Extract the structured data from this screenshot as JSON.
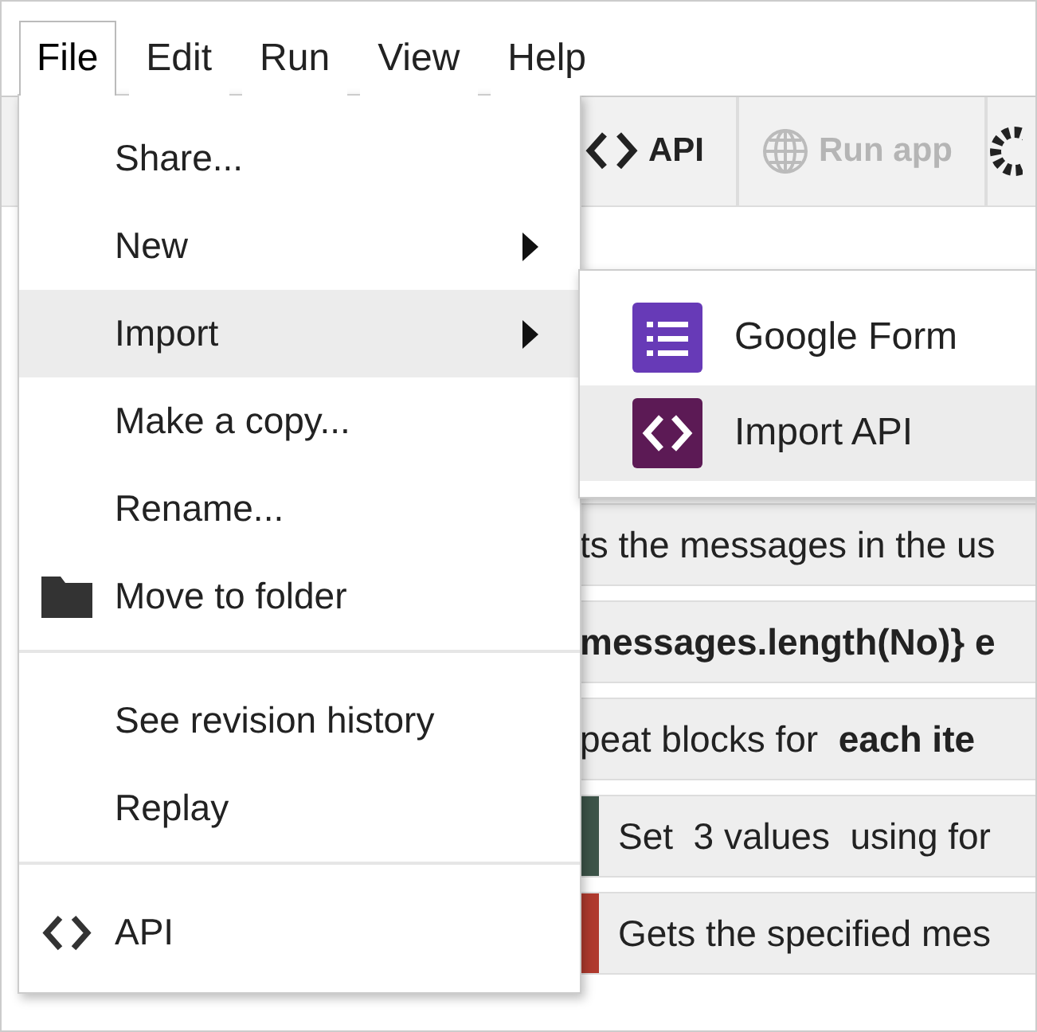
{
  "menubar": [
    {
      "label": "File",
      "selected": true
    },
    {
      "label": "Edit",
      "selected": false
    },
    {
      "label": "Run",
      "selected": false
    },
    {
      "label": "View",
      "selected": false
    },
    {
      "label": "Help",
      "selected": false
    }
  ],
  "toolbar": [
    {
      "label": "API",
      "kind": "api",
      "disabled": false
    },
    {
      "label": "Run app",
      "kind": "run",
      "disabled": true
    }
  ],
  "blocks": [
    {
      "text": "ts the messages in the us",
      "kind": "plain"
    },
    {
      "text": "messages.length(No)} e",
      "kind": "bold"
    },
    {
      "text": "peat blocks for  **each ite**",
      "kind": "plain"
    },
    {
      "text": "Set  3 values  using for",
      "kind": "set"
    },
    {
      "text": "Gets the specified mes",
      "kind": "get"
    }
  ],
  "file_menu": {
    "sections": [
      [
        {
          "label": "Share...",
          "kind": "plain",
          "submenu": false,
          "highlighted": false
        },
        {
          "label": "New",
          "kind": "plain",
          "submenu": true,
          "highlighted": false
        },
        {
          "label": "Import",
          "kind": "plain",
          "submenu": true,
          "highlighted": true
        },
        {
          "label": "Make a copy...",
          "kind": "plain",
          "submenu": false,
          "highlighted": false
        },
        {
          "label": "Rename...",
          "kind": "plain",
          "submenu": false,
          "highlighted": false
        },
        {
          "label": "Move to folder",
          "kind": "folder",
          "submenu": false,
          "highlighted": false
        }
      ],
      [
        {
          "label": "See revision history",
          "kind": "plain",
          "submenu": false,
          "highlighted": false
        },
        {
          "label": "Replay",
          "kind": "plain",
          "submenu": false,
          "highlighted": false
        }
      ],
      [
        {
          "label": "API",
          "kind": "code",
          "submenu": false,
          "highlighted": false
        }
      ]
    ]
  },
  "import_submenu": [
    {
      "label": "Google Form",
      "kind": "form",
      "highlighted": false
    },
    {
      "label": "Import API",
      "kind": "api",
      "highlighted": true
    }
  ]
}
